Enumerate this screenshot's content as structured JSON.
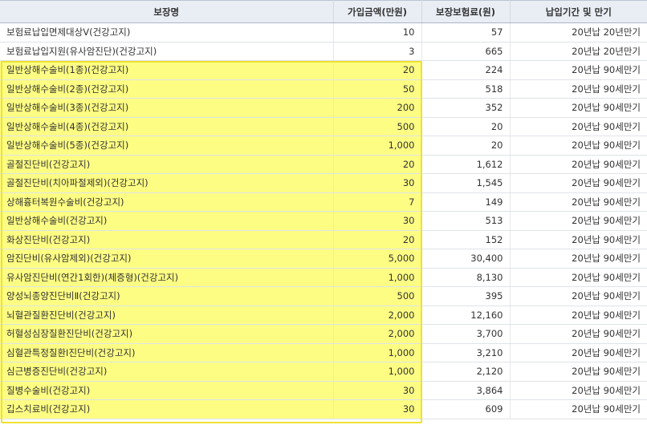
{
  "table": {
    "headers": [
      "보장명",
      "가입금액(만원)",
      "보장보험료(원)",
      "납입기간 및 만기"
    ],
    "rows": [
      {
        "name": "보험료납입면제대상Ⅴ(건강고지)",
        "amount": "10",
        "premium": "57",
        "term": "20년납 20년만기",
        "highlight": false
      },
      {
        "name": "보험료납입지원(유사암진단)(건강고지)",
        "amount": "3",
        "premium": "665",
        "term": "20년납 20년만기",
        "highlight": false
      },
      {
        "name": "일반상해수술비(1종)(건강고지)",
        "amount": "20",
        "premium": "224",
        "term": "20년납 90세만기",
        "highlight": true
      },
      {
        "name": "일반상해수술비(2종)(건강고지)",
        "amount": "50",
        "premium": "518",
        "term": "20년납 90세만기",
        "highlight": true
      },
      {
        "name": "일반상해수술비(3종)(건강고지)",
        "amount": "200",
        "premium": "352",
        "term": "20년납 90세만기",
        "highlight": true
      },
      {
        "name": "일반상해수술비(4종)(건강고지)",
        "amount": "500",
        "premium": "20",
        "term": "20년납 90세만기",
        "highlight": true
      },
      {
        "name": "일반상해수술비(5종)(건강고지)",
        "amount": "1,000",
        "premium": "20",
        "term": "20년납 90세만기",
        "highlight": true
      },
      {
        "name": "골절진단비(건강고지)",
        "amount": "20",
        "premium": "1,612",
        "term": "20년납 90세만기",
        "highlight": true
      },
      {
        "name": "골절진단비(치아파절제외)(건강고지)",
        "amount": "30",
        "premium": "1,545",
        "term": "20년납 90세만기",
        "highlight": true
      },
      {
        "name": "상해흉터복원수술비(건강고지)",
        "amount": "7",
        "premium": "149",
        "term": "20년납 90세만기",
        "highlight": true
      },
      {
        "name": "일반상해수술비(건강고지)",
        "amount": "30",
        "premium": "513",
        "term": "20년납 90세만기",
        "highlight": true
      },
      {
        "name": "화상진단비(건강고지)",
        "amount": "20",
        "premium": "152",
        "term": "20년납 90세만기",
        "highlight": true
      },
      {
        "name": "암진단비(유사암제외)(건강고지)",
        "amount": "5,000",
        "premium": "30,400",
        "term": "20년납 90세만기",
        "highlight": true
      },
      {
        "name": "유사암진단비(연간1회한)(체증형)(건강고지)",
        "amount": "1,000",
        "premium": "8,130",
        "term": "20년납 90세만기",
        "highlight": true
      },
      {
        "name": "양성뇌종양진단비Ⅱ(건강고지)",
        "amount": "500",
        "premium": "395",
        "term": "20년납 90세만기",
        "highlight": true
      },
      {
        "name": "뇌혈관질환진단비(건강고지)",
        "amount": "2,000",
        "premium": "12,160",
        "term": "20년납 90세만기",
        "highlight": true
      },
      {
        "name": "허혈성심장질환진단비(건강고지)",
        "amount": "2,000",
        "premium": "3,700",
        "term": "20년납 90세만기",
        "highlight": true
      },
      {
        "name": "심혈관특정질환Ⅰ진단비(건강고지)",
        "amount": "1,000",
        "premium": "3,210",
        "term": "20년납 90세만기",
        "highlight": true
      },
      {
        "name": "심근병증진단비(건강고지)",
        "amount": "1,000",
        "premium": "2,120",
        "term": "20년납 90세만기",
        "highlight": true
      },
      {
        "name": "질병수술비(건강고지)",
        "amount": "30",
        "premium": "3,864",
        "term": "20년납 90세만기",
        "highlight": true
      },
      {
        "name": "깁스치료비(건강고지)",
        "amount": "30",
        "premium": "609",
        "term": "20년납 90세만기",
        "highlight": true
      }
    ]
  },
  "colors": {
    "highlight_fill": "#fdfd84",
    "highlight_border": "#f0e130",
    "header_bg": "#e9eef5"
  }
}
